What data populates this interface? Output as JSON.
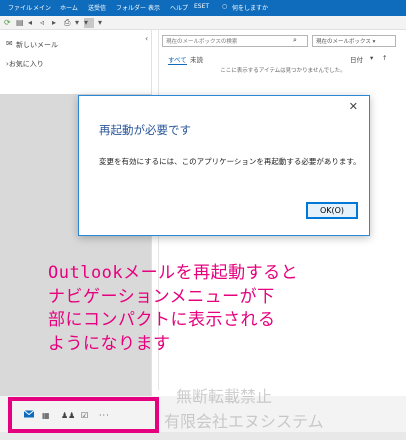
{
  "ribbon": {
    "tabs": [
      "ファイル",
      "メイン",
      "ホーム",
      "送受信",
      "フォルダー",
      "表示",
      "ヘルプ",
      "ESET"
    ],
    "tell_me": "何をしますか"
  },
  "folder_pane": {
    "new_mail": "新しいメール",
    "favorites": "お気に入り"
  },
  "message_list": {
    "search_placeholder": "現在のメールボックスの検索",
    "search_scope": "現在のメールボックス",
    "filter_all": "すべて",
    "filter_unread": "未読",
    "sort": "日付",
    "sort_arrow": "↑",
    "empty_text": "ここに表示するアイテムは見つかりませんでした。"
  },
  "dialog": {
    "title": "再起動が必要です",
    "message": "変更を有効にするには、このアプリケーションを再起動する必要があります。",
    "ok_button": "OK(O)",
    "close_glyph": "✕"
  },
  "annotation": {
    "line1": "Outlookメールを再起動すると",
    "line2": "ナビゲーションメニューが下",
    "line3": "部にコンパクトに表示される",
    "line4": "ようになります",
    "color": "#e6007e"
  },
  "watermark": {
    "line1": "無断転載禁止",
    "line2": "有限会社エヌシステム"
  },
  "nav_icons": [
    "mail-icon",
    "calendar-icon",
    "people-icon",
    "tasks-icon",
    "more-icon"
  ],
  "colors": {
    "ribbon_blue": "#0f6cbd",
    "dialog_title": "#2b579a",
    "highlight": "#e4007f"
  }
}
